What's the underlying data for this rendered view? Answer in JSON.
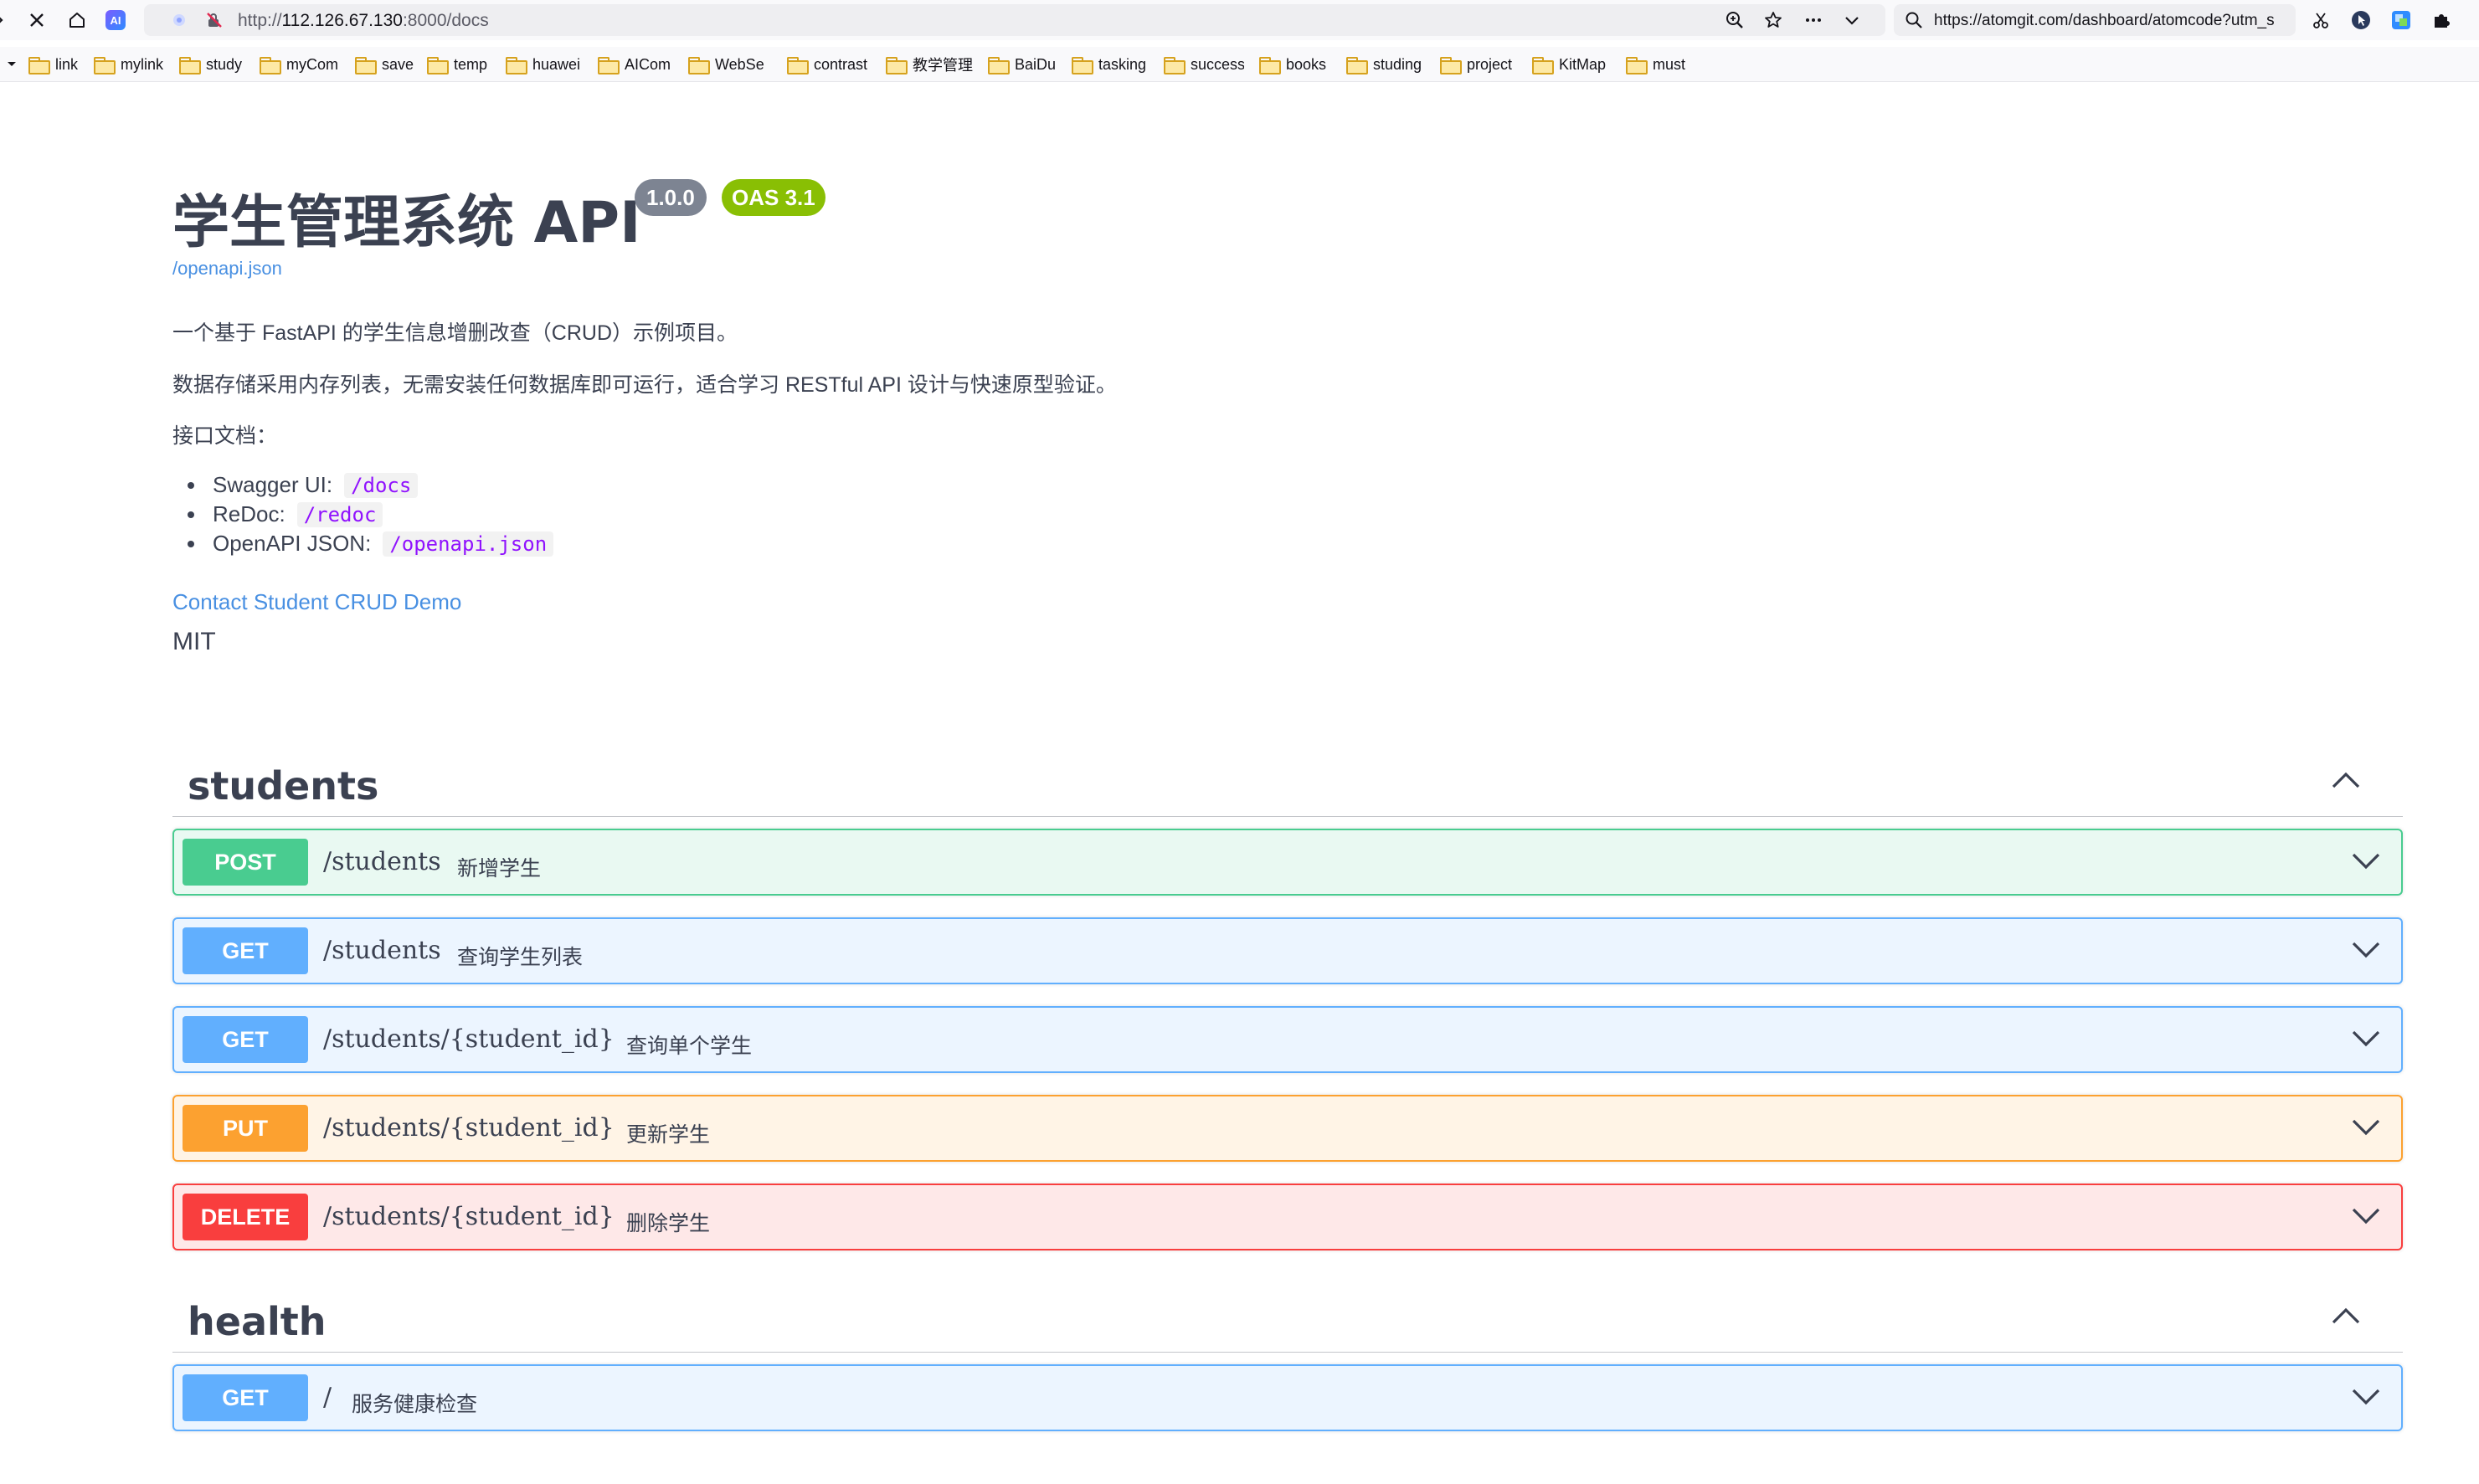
{
  "browser": {
    "url_scheme": "http://",
    "url_host": "112.126.67.130",
    "url_rest": ":8000/docs",
    "search_text": "https://atomgit.com/dashboard/atomcode?utm_s",
    "ai_badge": "AI"
  },
  "bookmarks": [
    "link",
    "mylink",
    "study",
    "myCom",
    "save",
    "temp",
    "huawei",
    "AICom",
    "WebSe",
    "contrast",
    "教学管理",
    "BaiDu",
    "tasking",
    "success",
    "books",
    "studing",
    "project",
    "KitMap",
    "must"
  ],
  "info": {
    "title": "学生管理系统 API",
    "version": "1.0.0",
    "oas": "OAS 3.1",
    "spec_link": "/openapi.json",
    "desc1": "一个基于 FastAPI 的学生信息增删改查（CRUD）示例项目。",
    "desc2": "数据存储采用内存列表，无需安装任何数据库即可运行，适合学习 RESTful API 设计与快速原型验证。",
    "desc3": "接口文档：",
    "docs": [
      {
        "label": "Swagger UI:",
        "code": "/docs"
      },
      {
        "label": "ReDoc:",
        "code": "/redoc"
      },
      {
        "label": "OpenAPI JSON:",
        "code": "/openapi.json"
      }
    ],
    "contact": "Contact Student CRUD Demo",
    "license": "MIT"
  },
  "tags": [
    {
      "name": "students",
      "operations": [
        {
          "method": "POST",
          "path": "/students",
          "summary": "新增学生"
        },
        {
          "method": "GET",
          "path": "/students",
          "summary": "查询学生列表"
        },
        {
          "method": "GET",
          "path": "/students/{student_id}",
          "summary": "查询单个学生"
        },
        {
          "method": "PUT",
          "path": "/students/{student_id}",
          "summary": "更新学生"
        },
        {
          "method": "DELETE",
          "path": "/students/{student_id}",
          "summary": "删除学生"
        }
      ]
    },
    {
      "name": "health",
      "operations": [
        {
          "method": "GET",
          "path": "/",
          "summary": "服务健康检查"
        }
      ]
    }
  ],
  "colors": {
    "post": "#49cc90",
    "get": "#61affe",
    "put": "#fca130",
    "delete": "#f93e3e",
    "version_badge": "#7d8492",
    "oas_badge": "#89bf04",
    "link": "#4990e2"
  }
}
